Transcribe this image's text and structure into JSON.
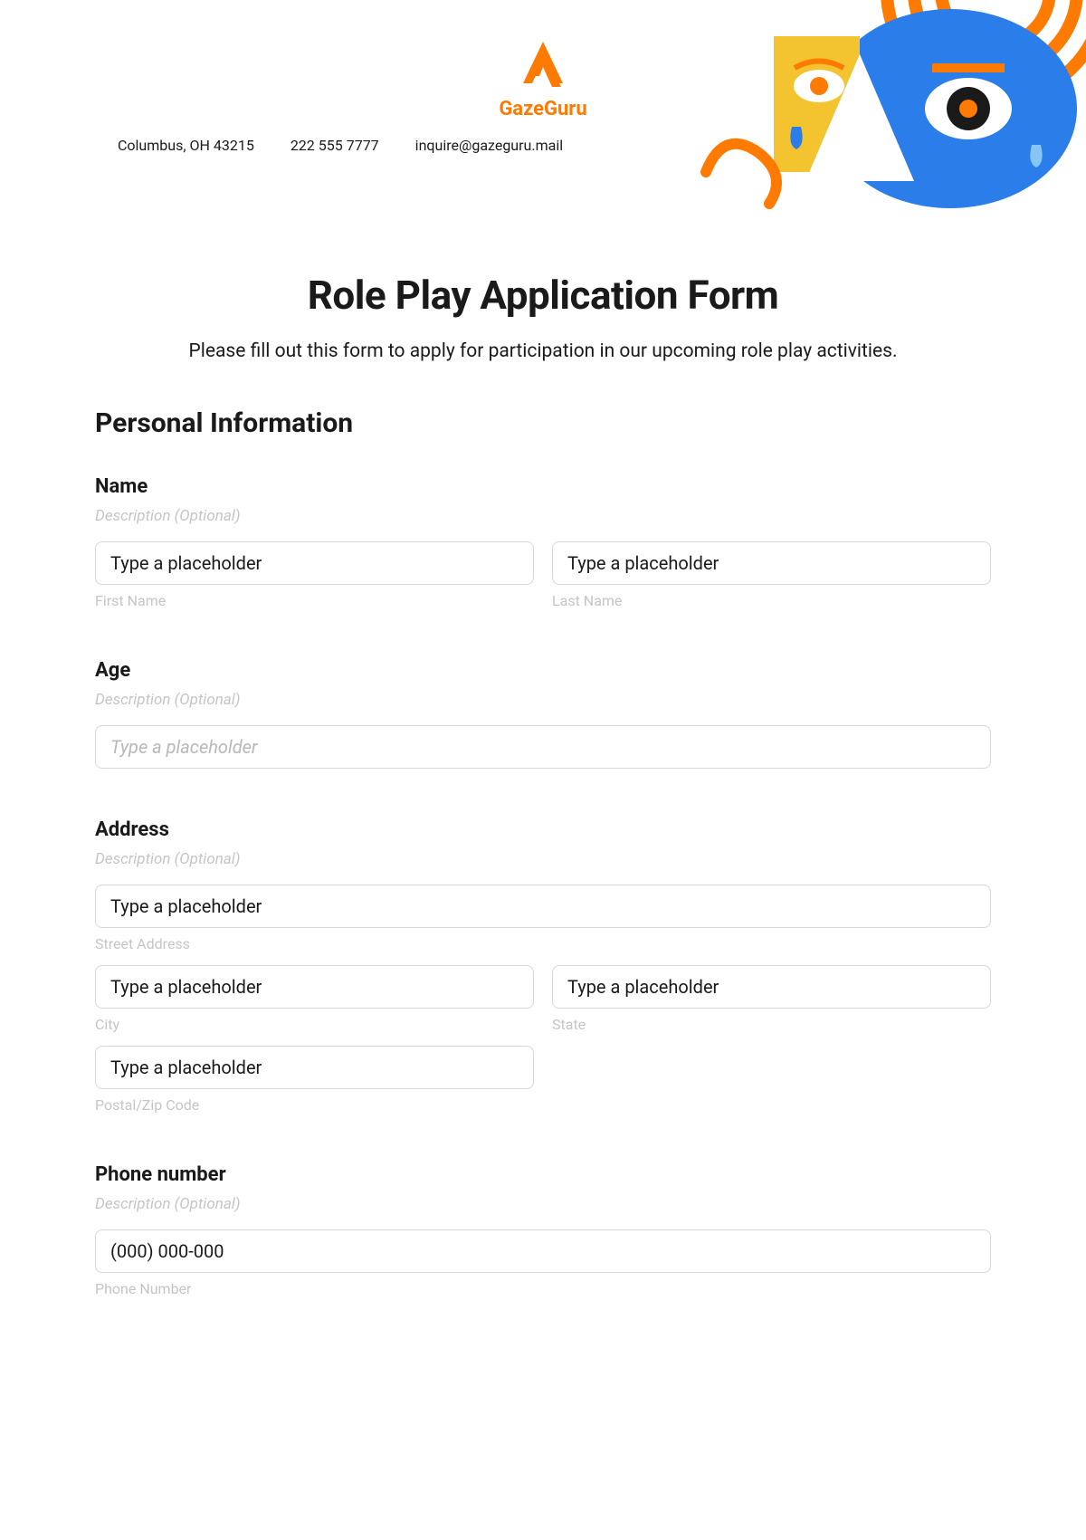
{
  "header": {
    "logo_text": "GazeGuru",
    "address": "Columbus, OH 43215",
    "phone": "222 555 7777",
    "email": "inquire@gazeguru.mail"
  },
  "title": "Role Play Application Form",
  "subtitle": "Please fill out this form to apply for participation in our upcoming role play activities.",
  "section_personal": "Personal Information",
  "fields": {
    "name": {
      "label": "Name",
      "desc": "Description (Optional)",
      "first": {
        "value": "Type a placeholder",
        "sub": "First Name"
      },
      "last": {
        "value": "Type a placeholder",
        "sub": "Last Name"
      }
    },
    "age": {
      "label": "Age",
      "desc": "Description (Optional)",
      "placeholder": "Type a placeholder"
    },
    "address": {
      "label": "Address",
      "desc": "Description (Optional)",
      "street": {
        "value": "Type a placeholder",
        "sub": "Street Address"
      },
      "city": {
        "value": "Type a placeholder",
        "sub": "City"
      },
      "state": {
        "value": "Type a placeholder",
        "sub": "State"
      },
      "postal": {
        "value": "Type a placeholder",
        "sub": "Postal/Zip Code"
      }
    },
    "phone": {
      "label": "Phone number",
      "desc": "Description (Optional)",
      "value": "(000) 000-000",
      "sub": "Phone Number"
    }
  }
}
